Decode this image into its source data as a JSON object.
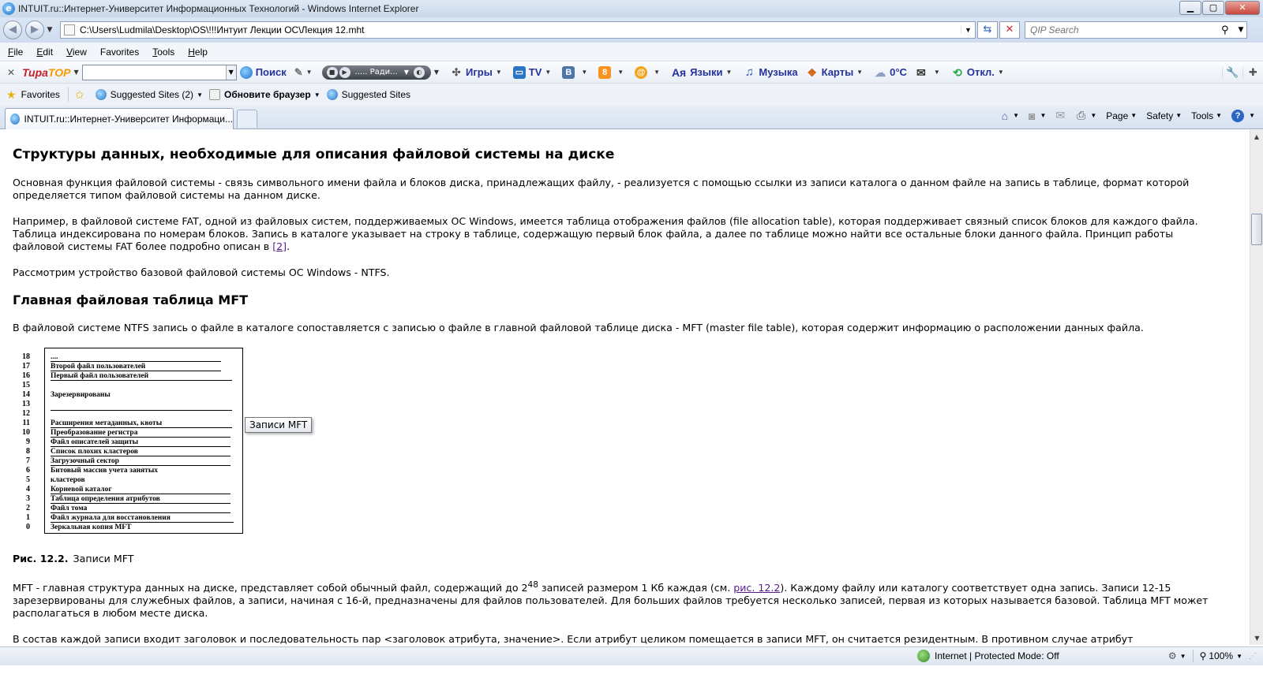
{
  "window": {
    "title": "INTUIT.ru::Интернет-Университет Информационных Технологий - Windows Internet Explorer"
  },
  "addressbar": {
    "url": "C:\\Users\\Ludmila\\Desktop\\OS\\!!!Интуит Лекции ОС\\Лекция 12.mht",
    "search_placeholder": "QIP Search"
  },
  "menubar": {
    "items": [
      {
        "first": "F",
        "rest": "ile"
      },
      {
        "first": "E",
        "rest": "dit"
      },
      {
        "first": "V",
        "rest": "iew"
      },
      {
        "first": "",
        "rest": "Favorites"
      },
      {
        "first": "T",
        "rest": "ools"
      },
      {
        "first": "H",
        "rest": "elp"
      }
    ]
  },
  "toolbar": {
    "logo_a": "Тира",
    "logo_b": "ТОР",
    "search_label": "Поиск",
    "radio_name": "..... Ради...",
    "games": "Игры",
    "tv": "TV",
    "vk": "B",
    "ok": "8",
    "mail": "@",
    "lang_icon": "Ая",
    "languages": "Языки",
    "music": "Музыка",
    "maps": "Карты",
    "temperature": "0°C",
    "off": "Откл."
  },
  "favorites": {
    "label": "Favorites",
    "items": [
      {
        "label": "Suggested Sites (2)"
      },
      {
        "label": "Обновите браузер"
      },
      {
        "label": "Suggested Sites"
      }
    ]
  },
  "tabs": {
    "active_label": "INTUIT.ru::Интернет-Университет Информаци..."
  },
  "commands": {
    "page": "Page",
    "safety": "Safety",
    "tools": "Tools",
    "help": "?"
  },
  "content": {
    "h1": "Структуры данных, необходимые для описания файловой системы на диске",
    "p1": "Основная функция файловой системы - связь символьного имени файла и блоков диска, принадлежащих файлу, - реализуется с помощью ссылки из записи каталога о данном файле на запись в таблице, формат которой определяется типом файловой системы на данном диске.",
    "p2_text": "Например, в файловой системе FAT, одной из файловых систем, поддерживаемых ОС Windows, имеется таблица отображения файлов (file allocation table), которая поддерживает связный список блоков для каждого файла. Таблица индексирована по номерам блоков. Запись в каталоге указывает на строку в таблице, содержащую первый блок файла, а далее по таблице можно найти все остальные блоки данного файла. Принцип работы файловой системы FAT более подробно описан в ",
    "p2_link": "[2]",
    "p2_end": ".",
    "p3": "Рассмотрим устройство базовой файловой системы ОС Windows - NTFS.",
    "h2": "Главная файловая таблица MFT",
    "p4": "В файловой системе NTFS запись о файле в каталоге сопоставляется с записью о файле в главной файловой таблице диска - MFT (master file table), которая содержит информацию о расположении данных файла.",
    "figure": {
      "numbers": [
        "18",
        "17",
        "16",
        "15",
        "14",
        "13",
        "12",
        "11",
        "10",
        "9",
        "8",
        "7",
        "6",
        "5",
        "4",
        "3",
        "2",
        "1",
        "0"
      ],
      "rows": [
        "....",
        "Второй файл пользователей",
        "Первый файл пользователей",
        "Зарезервированы",
        "Расширения метаданных, квоты",
        "Преобразование регистра",
        "Файл описателей защиты",
        "Список плохих кластеров",
        "Загрузочный сектор",
        "Битовый массив учета занятых",
        "кластеров",
        "Корневой каталог",
        "Таблица определения атрибутов",
        "Файл тома",
        "Файл журнала для восстановления",
        "Зеркальная копия MFT"
      ],
      "tooltip": "Записи MFT"
    },
    "caption_bold": "Рис. 12.2.",
    "caption_text": "Записи MFT",
    "p5_a": "MFT - главная структура данных на диске, представляет собой обычный файл, содержащий до 2",
    "p5_sup": "48",
    "p5_b": " записей размером 1 Кб каждая (см. ",
    "p5_link": "рис. 12.2",
    "p5_c": "). Каждому файлу или каталогу соответствует одна запись. Записи 12-15 зарезервированы для служебных файлов, а записи, начиная с 16-й, предназначены для файлов пользователей. Для больших файлов требуется несколько записей, первая из которых называется базовой. Таблица MFT может располагаться в любом месте диска.",
    "p6": "В состав каждой записи входит заголовок и последовательность пар <заголовок атрибута, значение>. Если атрибут целиком помещается в записи MFT, он считается резидентным. В противном случае атрибут"
  },
  "statusbar": {
    "zone": "Internet | Protected Mode: Off",
    "zoom": "100%"
  }
}
